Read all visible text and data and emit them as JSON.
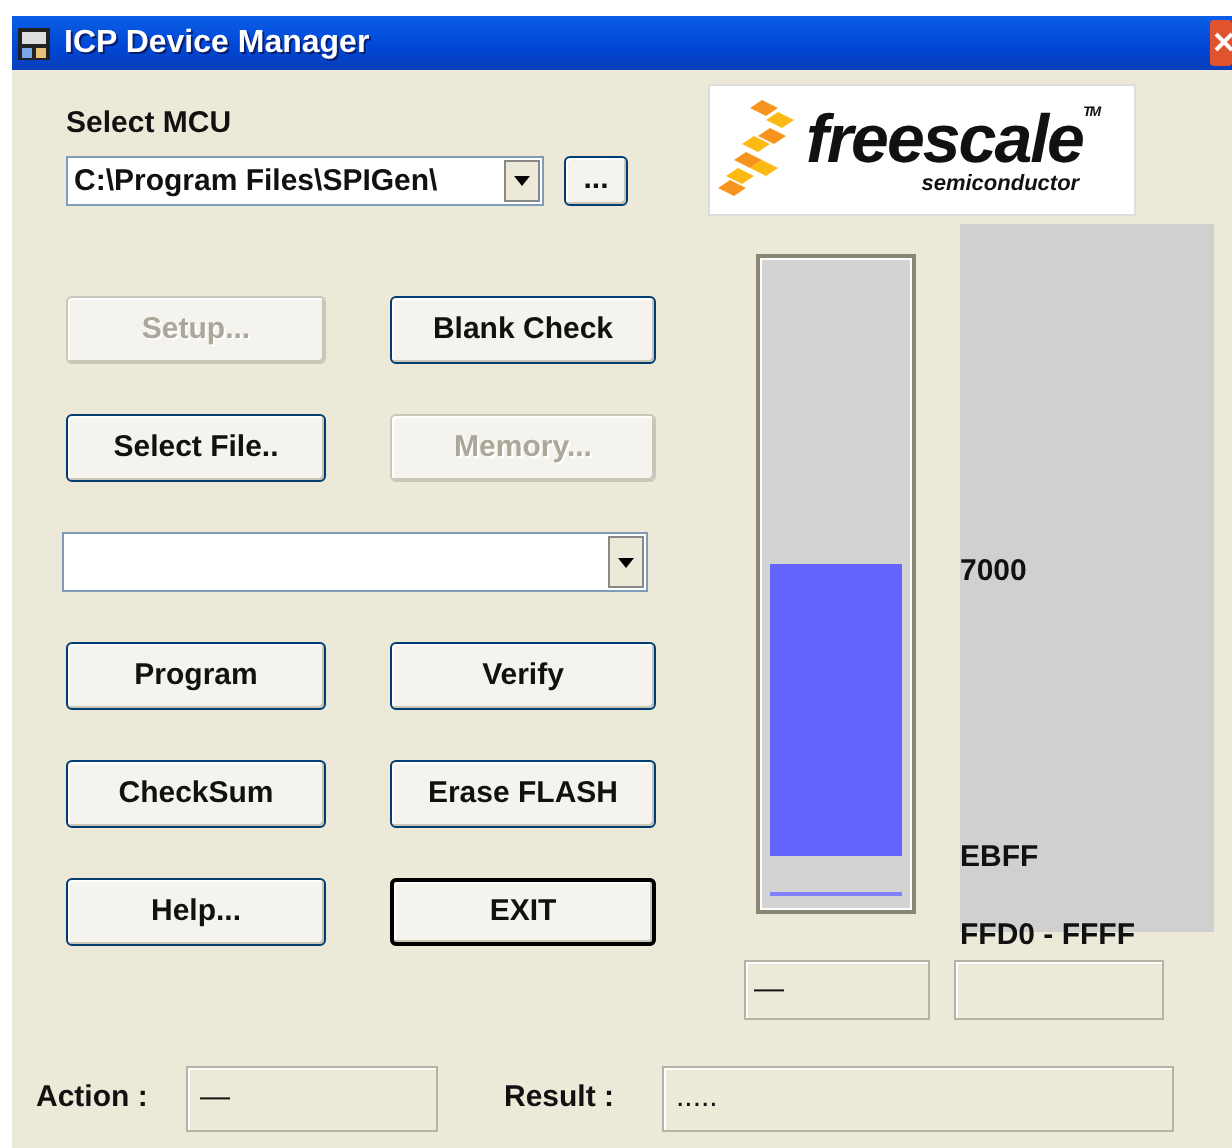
{
  "window": {
    "title": "ICP Device Manager"
  },
  "mcu": {
    "label": "Select MCU",
    "value": "C:\\Program Files\\SPIGen\\",
    "browse": "..."
  },
  "logo": {
    "name": "freescale",
    "tm": "TM",
    "tagline": "semiconductor"
  },
  "controls": [
    {
      "kind": "button",
      "label": "Setup...",
      "disabled": true,
      "default": false
    },
    {
      "kind": "button",
      "label": "Blank Check",
      "disabled": false,
      "default": false
    },
    {
      "kind": "button",
      "label": "Select File..",
      "disabled": false,
      "default": false
    },
    {
      "kind": "button",
      "label": "Memory...",
      "disabled": true,
      "default": false
    },
    {
      "kind": "combo"
    },
    {
      "kind": "button",
      "label": "Program",
      "disabled": false,
      "default": false
    },
    {
      "kind": "button",
      "label": "Verify",
      "disabled": false,
      "default": false
    },
    {
      "kind": "button",
      "label": "CheckSum",
      "disabled": false,
      "default": false
    },
    {
      "kind": "button",
      "label": "Erase FLASH",
      "disabled": false,
      "default": false
    },
    {
      "kind": "button",
      "label": "Help...",
      "disabled": false,
      "default": false
    },
    {
      "kind": "button",
      "label": "EXIT",
      "disabled": false,
      "default": true
    }
  ],
  "memory": {
    "level": 0.49,
    "labels": [
      "7000",
      "EBFF",
      "FFD0 - FFFF"
    ],
    "readout": "—"
  },
  "status": {
    "action_label": "Action :",
    "action": "—",
    "result_label": "Result :",
    "result": "....."
  }
}
